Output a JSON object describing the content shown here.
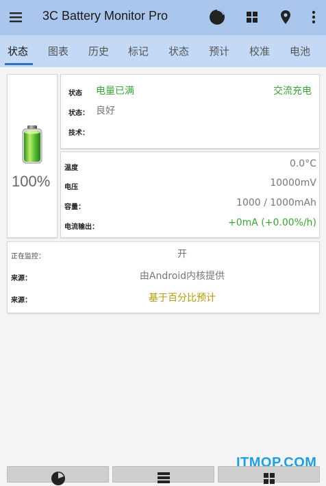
{
  "appbar": {
    "title": "3C Battery Monitor Pro",
    "icons": [
      "menu-icon",
      "pie-chart-icon",
      "grid-icon",
      "location-pin-icon",
      "more-vert-icon"
    ]
  },
  "tabs": [
    {
      "label": "状态",
      "active": true
    },
    {
      "label": "图表"
    },
    {
      "label": "历史"
    },
    {
      "label": "标记"
    },
    {
      "label": "状态"
    },
    {
      "label": "预计"
    },
    {
      "label": "校准"
    },
    {
      "label": "电池"
    }
  ],
  "battery": {
    "percent": "100%",
    "level": 1.0,
    "icon": "battery-full-icon"
  },
  "status_card": {
    "status_label": "状态",
    "status_value": "电量已满",
    "charge_type": "交流充电",
    "health_label": "状态：",
    "health_value": "良好",
    "tech_label": "技术："
  },
  "stats_card": {
    "temp_label": "温度",
    "temp_value": "0.0°C",
    "voltage_label": "电压",
    "voltage_value": "10000mV",
    "capacity_label": "容量：",
    "capacity_value": "1000 / 1000mAh",
    "current_label": "电流输出：",
    "current_value": "+0mA (+0.00%/h)"
  },
  "monitor_card": {
    "monitoring_label": "正在监控：",
    "monitoring_value": "开",
    "source1_label": "来源：",
    "source1_value": "由Android内核提供",
    "source2_label": "来源：",
    "source2_value": "基于百分比预计"
  },
  "bottom_bar": {
    "icons": [
      "pie-chart-icon",
      "list-icon",
      "grid-icon"
    ]
  },
  "watermark": "ITMOP.COM",
  "colors": {
    "appbar": "#aac6ec",
    "tabbar": "#c4d9f5",
    "accent": "#2f6fc0",
    "good": "#3aa535",
    "estimate": "#b39a08"
  }
}
